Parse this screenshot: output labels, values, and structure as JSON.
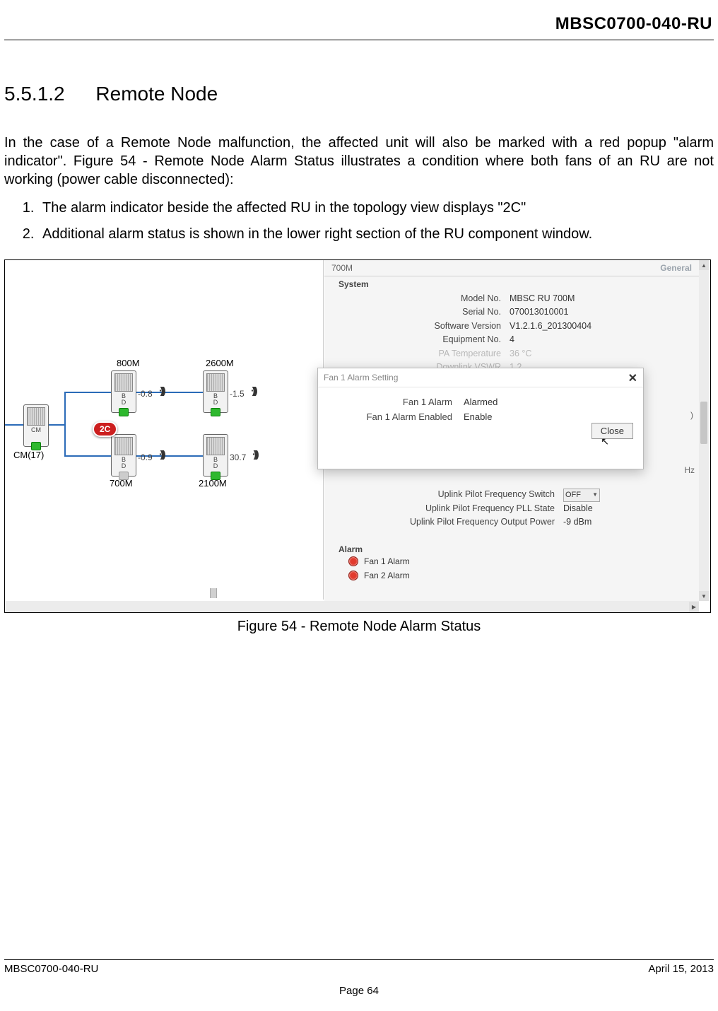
{
  "doc": {
    "header_code": "MBSC0700-040-RU",
    "section_number": "5.5.1.2",
    "section_title": "Remote Node",
    "para1": "In the case of a Remote Node malfunction, the affected unit will also be marked with a red popup \"alarm indicator\". Figure 54 - Remote Node Alarm Status illustrates a condition where both fans of an RU are not working (power cable disconnected):",
    "li1": "The alarm indicator beside the affected RU in the topology view displays \"2C\"",
    "li2": "Additional alarm status is shown in the lower right section of the RU component window.",
    "figure_caption": "Figure 54 - Remote Node Alarm Status",
    "footer_left": "MBSC0700-040-RU",
    "footer_right": "April 15, 2013",
    "footer_page": "Page 64"
  },
  "topology": {
    "cm_label": "CM(17)",
    "cm_type": "CM",
    "n800_label": "800M",
    "n2600_label": "2600M",
    "n700_label": "700M",
    "n2100_label": "2100M",
    "bd_type_a": "B",
    "bd_type_b": "D",
    "val_800": "-0.8",
    "val_2600": "-1.5",
    "val_700": "-0.9",
    "val_2100": "30.7",
    "alarm_badge": "2C"
  },
  "details": {
    "panel_title": "700M",
    "panel_general": "General",
    "sys_hdr": "System",
    "rows": [
      {
        "k": "Model No.",
        "v": "MBSC RU 700M"
      },
      {
        "k": "Serial No.",
        "v": "070013010001"
      },
      {
        "k": "Software Version",
        "v": "V1.2.1.6_201300404"
      },
      {
        "k": "Equipment No.",
        "v": "4"
      }
    ],
    "dim_rows": [
      {
        "k": "PA Temperature",
        "v": "36   °C"
      },
      {
        "k": "Downlink VSWR",
        "v": "1.2"
      }
    ],
    "uplink_rows": [
      {
        "k": "Uplink Pilot Frequency Switch",
        "v": ""
      },
      {
        "k": "Uplink Pilot Frequency PLL State",
        "v": "Disable"
      },
      {
        "k": "Uplink Pilot Frequency Output Power",
        "v": "-9   dBm"
      }
    ],
    "off_value": "OFF",
    "hz_fragment": "Hz",
    "alarm_hdr": "Alarm",
    "alarm1": "Fan 1 Alarm",
    "alarm2": "Fan 2 Alarm"
  },
  "popup": {
    "title": "Fan 1 Alarm Setting",
    "row1_k": "Fan 1 Alarm",
    "row1_v": "Alarmed",
    "row2_k": "Fan 1 Alarm Enabled",
    "row2_v": "Enable",
    "close_btn": "Close",
    "close_x": "✕"
  }
}
